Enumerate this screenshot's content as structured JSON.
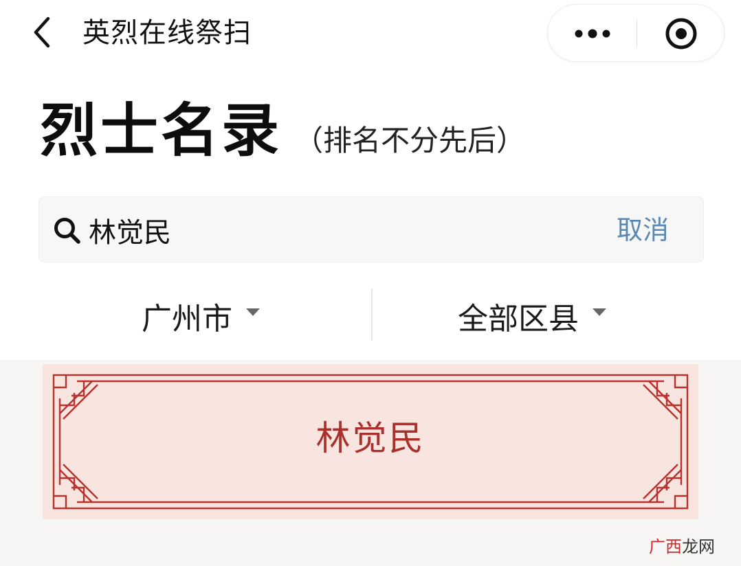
{
  "navbar": {
    "title": "英烈在线祭扫",
    "back_icon": "chevron-left-icon",
    "more_icon": "ellipsis-icon",
    "close_icon": "record-circle-icon"
  },
  "heading": {
    "main": "烈士名录",
    "sub": "（排名不分先后）"
  },
  "search": {
    "icon": "search-icon",
    "value": "林觉民",
    "cancel_label": "取消"
  },
  "filters": {
    "city": "广州市",
    "district": "全部区县"
  },
  "results": [
    {
      "name": "林觉民"
    }
  ],
  "watermark": {
    "part1": "广西",
    "part2": "龙网"
  },
  "colors": {
    "link": "#5a88b5",
    "card_bg": "#f8e5df",
    "card_border": "#b9302c",
    "card_text": "#a9302d"
  }
}
